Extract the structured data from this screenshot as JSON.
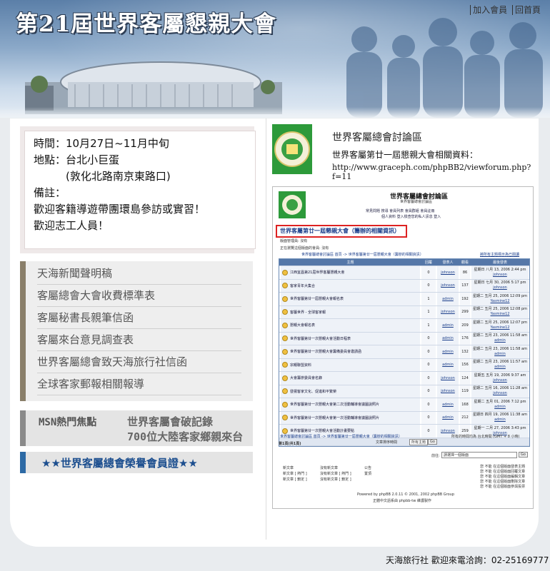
{
  "header": {
    "title": "第21屆世界客屬懇親大會",
    "links": [
      "加入會員",
      "回首頁"
    ]
  },
  "info": {
    "line1": "時間：10月27日~11月中旬",
    "line2": "地點：台北小巨蛋",
    "line3": "　　　(敦化北路南京東路口)",
    "line4": "備註：",
    "line5": "歡迎客籍導遊帶團環島參訪或實習！",
    "line6": "歡迎志工人員！"
  },
  "menu": {
    "items": [
      "天海新聞聲明稿",
      "客屬總會大會收費標準表",
      "客屬秘書長親筆信函",
      "客屬來台意見調查表",
      "世界客屬總會致天海旅行社信函",
      "全球客家郵報相關報導"
    ]
  },
  "msn": {
    "title": "MSN熱門焦點",
    "link1": "世界客屬會破記錄",
    "link2": "700位大陸客家鄉親來台"
  },
  "member": {
    "label": "★★世界客屬總會榮譽會員證★★"
  },
  "forum": {
    "title": "世界客屬總會討論區",
    "desc": "世界客屬第廿一屆懇親大會相關資料：",
    "url": "http://www.graceph.com/phpBB2/viewforum.php?f=11",
    "logo_text": "世界客屬總會",
    "screenshot": {
      "board_title": "世界客屬總會討論區",
      "board_sub": "世界客屬總會討論區",
      "nav1": "常見問題  搜尋  會員列表  會員群組  會員註冊",
      "nav2": "個人資料  登入檢查您的私人訊息  登入",
      "highlight": "世界客屬第廿一屆懇親大會（籌辦的相關資訊）",
      "moderators": "版面管理員: 沒有",
      "browsing": "正在瀏覽這個版面的會員: 沒有",
      "breadcrumb": "世界客屬總會討論區 首頁 -> 世界客屬第廿一屆懇親大會（籌辦的相關資訊）",
      "mark_read": "將所有主題標示為已閱讀",
      "headers": [
        "主題",
        "回覆",
        "發表人",
        "觀看",
        "最後發表"
      ],
      "rows": [
        {
          "topic": "江西宜昌第21屆世界客屬懇親大會",
          "rep": "0",
          "author": "johnson",
          "views": "86",
          "last1": "星期日 八月 13, 2006 2:44 pm",
          "last2": "johnson"
        },
        {
          "topic": "客家青年大集合",
          "rep": "0",
          "author": "johnson",
          "views": "137",
          "last1": "星期日 七月 30, 2006 5:17 pm",
          "last2": "johnson"
        },
        {
          "topic": "世界客屬第廿一屆懇親大會報名表",
          "rep": "1",
          "author": "admin",
          "views": "192",
          "last1": "星期二 五月 25, 2006 12:09 pm",
          "last2": "Yasmine12"
        },
        {
          "topic": "客屬世界 - 全球客家報",
          "rep": "1",
          "author": "johnson",
          "views": "299",
          "last1": "星期二 五月 25, 2006 12:08 pm",
          "last2": "Yasmine12"
        },
        {
          "topic": "懇親大會報名表",
          "rep": "1",
          "author": "admin",
          "views": "209",
          "last1": "星期二 五月 25, 2006 12:07 pm",
          "last2": "Yasmine12"
        },
        {
          "topic": "世界客屬第廿一次懇親大會活動日程表",
          "rep": "0",
          "author": "admin",
          "views": "176",
          "last1": "星期二 五月 23, 2006 11:58 am",
          "last2": "admin"
        },
        {
          "topic": "世界客屬第廿一次懇親大會籌備委員會邀請函",
          "rep": "0",
          "author": "admin",
          "views": "132",
          "last1": "星期二 五月 23, 2006 11:58 am",
          "last2": "admin"
        },
        {
          "topic": "宗親聯盟資料",
          "rep": "0",
          "author": "admin",
          "views": "156",
          "last1": "星期二 五月 23, 2006 11:57 am",
          "last2": "admin"
        },
        {
          "topic": "大會籌辦委員會名錄",
          "rep": "0",
          "author": "johnson",
          "views": "124",
          "last1": "星期五 五月 19, 2006 9:37 am",
          "last2": "johnson"
        },
        {
          "topic": "發揚客家文化、促進和平繁榮",
          "rep": "0",
          "author": "johnson",
          "views": "119",
          "last1": "星期二 五月 16, 2006 11:28 am",
          "last2": "johnson"
        },
        {
          "topic": "世界客屬第廿一次懇親大會第二次活動輔導會議圖說照片",
          "rep": "0",
          "author": "admin",
          "views": "168",
          "last1": "星期二 五月 01, 2006 7:12 pm",
          "last2": "admin"
        },
        {
          "topic": "世界客屬第廿一次懇親大會第一次活動輔導會議圖說照片",
          "rep": "0",
          "author": "admin",
          "views": "212",
          "last1": "星期日 四月 19, 2006 11:38 am",
          "last2": "admin"
        },
        {
          "topic": "世界客屬第廿一次懇親大會活動計畫要點",
          "rep": "0",
          "author": "johnson",
          "views": "259",
          "last1": "星期一 二月 27, 2006 3:43 pm",
          "last2": "johnson"
        }
      ],
      "show_topics": "文章排序時間",
      "all_topics": "所有主題",
      "go": "Go",
      "tz": "所有的時間均為 台北時間 (GMT + 8 小時)",
      "page": "第1頁(共1頁)",
      "jump": "前往:",
      "jump_select": "請選擇一個版面",
      "legend_left": [
        "新文章",
        "新文章 [ 熱門 ]",
        "新文章 [ 鎖定 ]"
      ],
      "legend_mid": [
        "沒有新文章",
        "沒有新文章 [ 熱門 ]",
        "沒有新文章 [ 鎖定 ]"
      ],
      "legend_right": [
        "公告",
        "置頂"
      ],
      "perms": [
        "您 不能 在這個版面發表主題",
        "您 不能 在這個版面回覆文章",
        "您 不能 在這個版面編輯文章",
        "您 不能 在這個版面刪除文章",
        "您 不能 在這個版面參與投票"
      ],
      "powered": "Powered by phpBB 2.0.11 © 2001, 2002 phpBB Group",
      "powered2": "正體中文語系由 phpbb-tw 維護製作"
    }
  },
  "footer": {
    "text": "天海旅行社  歡迎來電洽詢：02-25169777"
  },
  "colors": {
    "header_blue": "#5b7fa8",
    "menu_bar": "#8a7f6a",
    "member_bar": "#2d6aa5",
    "highlight_red": "#dd2222"
  }
}
